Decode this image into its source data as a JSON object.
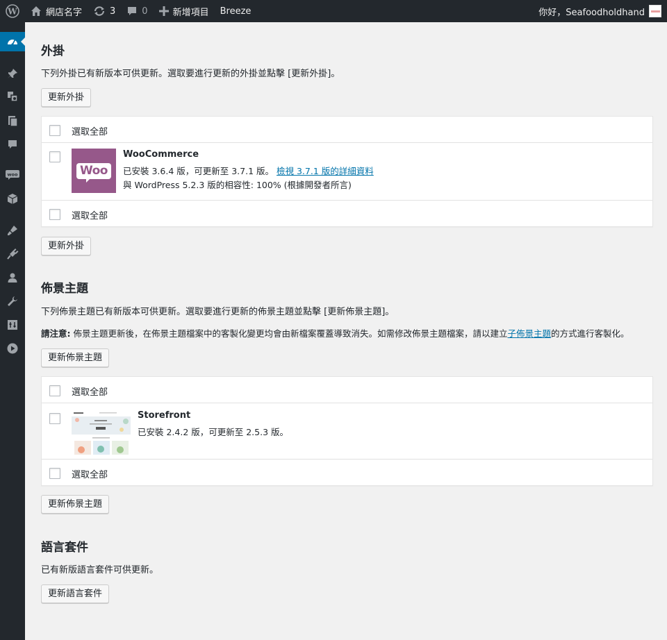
{
  "adminbar": {
    "site_name": "網店名字",
    "updates_count": "3",
    "comments_count": "0",
    "new_label": "新增項目",
    "plugin_label": "Breeze",
    "greeting": "你好，Seafoodholdhand"
  },
  "plugins": {
    "title": "外掛",
    "description": "下列外掛已有新版本可供更新。選取要進行更新的外掛並點擊 [更新外掛]。",
    "update_button": "更新外掛",
    "select_all": "選取全部",
    "item": {
      "name": "WooCommerce",
      "logo_text": "Woo",
      "installed_text": "已安裝 3.6.4 版，可更新至 3.7.1 版。",
      "details_link": "檢視 3.7.1 版的詳細資料",
      "compat_text": "與 WordPress 5.2.3 版的相容性: 100% (根據開發者所言)"
    }
  },
  "themes": {
    "title": "佈景主題",
    "description": "下列佈景主題已有新版本可供更新。選取要進行更新的佈景主題並點擊 [更新佈景主題]。",
    "notice_strong": "請注意:",
    "notice_text": " 佈景主題更新後，在佈景主題檔案中的客製化變更均會由新檔案覆蓋導致消失。如需修改佈景主題檔案，請以建立",
    "notice_link": "子佈景主題",
    "notice_tail": "的方式進行客製化。",
    "update_button": "更新佈景主題",
    "select_all": "選取全部",
    "item": {
      "name": "Storefront",
      "installed_text": "已安裝 2.4.2 版，可更新至 2.5.3 版。"
    }
  },
  "translations": {
    "title": "語言套件",
    "description": "已有新版語言套件可供更新。",
    "update_button": "更新語言套件"
  },
  "colors": {
    "adminbar_bg": "#23282d",
    "accent": "#0073aa",
    "woo_purple": "#96588a",
    "page_bg": "#f1f1f1"
  }
}
